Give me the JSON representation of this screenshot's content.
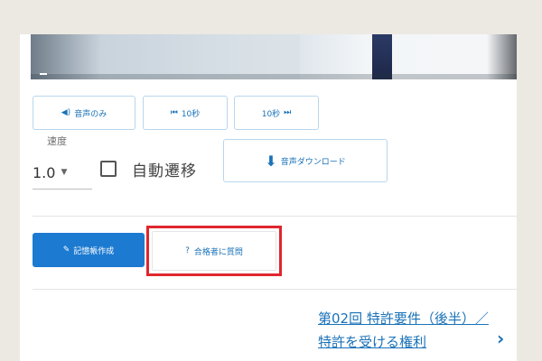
{
  "player": {
    "audio_only_label": "音声のみ",
    "back_label": "10秒",
    "forward_label": "10秒",
    "speed_label": "速度",
    "speed_value": "1.0",
    "auto_advance_label": "自動遷移",
    "auto_advance_checked": false,
    "download_label": "音声ダウンロード"
  },
  "actions": {
    "create_label": "記憶帳作成",
    "ask_label": "合格者に質問",
    "ask_highlighted": true,
    "highlight_color": "#e0262e"
  },
  "next": {
    "title": "第02回 特許要件（後半）／特許を受ける権利"
  },
  "icons": {
    "audio": "audio-icon",
    "rewind": "rewind-icon",
    "forward": "fast-forward-icon",
    "download": "download-icon",
    "create": "edit-icon",
    "ask": "question-icon",
    "next": "chevron-right-icon"
  },
  "colors": {
    "accent": "#1a72b8",
    "primary_button": "#1c7ad1",
    "background": "#ece9e2"
  }
}
